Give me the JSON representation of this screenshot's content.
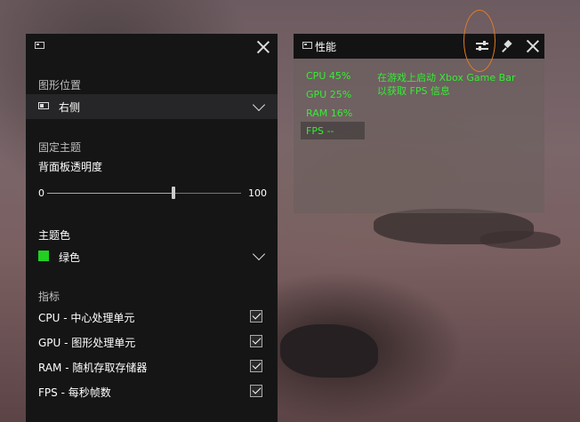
{
  "settings": {
    "position_label": "图形位置",
    "position_value": "右侧",
    "pin_label": "固定主题",
    "opacity_label": "背面板透明度",
    "opacity_min": "0",
    "opacity_max": "100",
    "opacity_value": 65,
    "theme_label": "主题色",
    "theme_value": "绿色",
    "theme_color": "#22d022",
    "metrics_label": "指标",
    "metrics": [
      {
        "label": "CPU - 中心处理单元",
        "checked": true
      },
      {
        "label": "GPU - 图形处理单元",
        "checked": true
      },
      {
        "label": "RAM - 随机存取存储器",
        "checked": true
      },
      {
        "label": "FPS - 每秒帧数",
        "checked": true
      }
    ]
  },
  "perf": {
    "title": "性能",
    "cpu": "CPU  45%",
    "gpu": "GPU  25%",
    "ram": "RAM  16%",
    "fps": "FPS --",
    "hint_line1": "在游戏上启动 Xbox Game Bar",
    "hint_line2": "以获取 FPS 信息",
    "stat_color": "#33ee33"
  },
  "icons": {
    "widget": "widget-icon",
    "close": "close-icon",
    "tune": "settings-sliders-icon",
    "pin": "pin-icon",
    "chevron": "chevron-down-icon",
    "check": "checkmark-icon"
  },
  "annotation_color": "#e07b22"
}
